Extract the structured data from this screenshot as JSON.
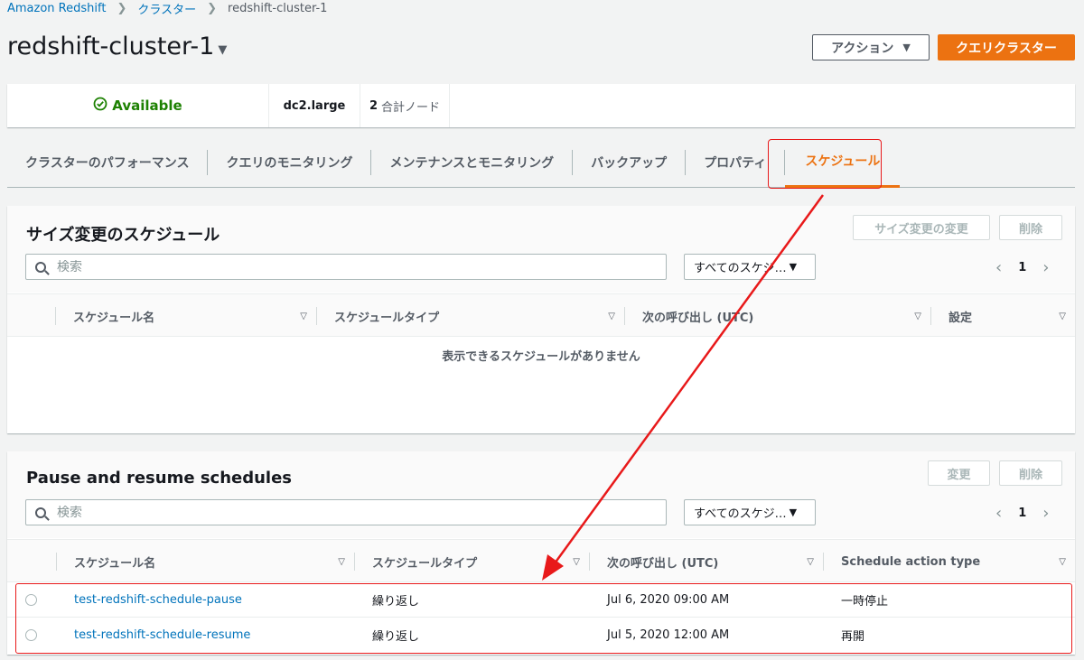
{
  "breadcrumb": {
    "items": [
      "Amazon Redshift",
      "クラスター"
    ],
    "current": "redshift-cluster-1"
  },
  "header": {
    "title": "redshift-cluster-1",
    "actions_label": "アクション",
    "query_label": "クエリクラスター"
  },
  "status": {
    "state": "Available",
    "node_type": "dc2.large",
    "node_count": "2",
    "node_label": "合計ノード"
  },
  "tabs": [
    {
      "label": "クラスターのパフォーマンス"
    },
    {
      "label": "クエリのモニタリング"
    },
    {
      "label": "メンテナンスとモニタリング"
    },
    {
      "label": "バックアップ"
    },
    {
      "label": "プロパティ"
    },
    {
      "label": "スケジュール",
      "active": true
    }
  ],
  "resize_panel": {
    "title": "サイズ変更のスケジュール",
    "modify_label": "サイズ変更の変更",
    "delete_label": "削除",
    "search_placeholder": "検索",
    "filter_value": "すべてのスケジ…",
    "page": "1",
    "columns": [
      "スケジュール名",
      "スケジュールタイプ",
      "次の呼び出し (UTC)",
      "設定"
    ],
    "empty_message": "表示できるスケジュールがありません"
  },
  "pause_panel": {
    "title": "Pause and resume schedules",
    "modify_label": "変更",
    "delete_label": "削除",
    "search_placeholder": "検索",
    "filter_value": "すべてのスケジ…",
    "page": "1",
    "columns": [
      "スケジュール名",
      "スケジュールタイプ",
      "次の呼び出し (UTC)",
      "Schedule action type"
    ],
    "rows": [
      {
        "name": "test-redshift-schedule-pause",
        "type": "繰り返し",
        "next": "Jul 6, 2020 09:00 AM",
        "action": "一時停止"
      },
      {
        "name": "test-redshift-schedule-resume",
        "type": "繰り返し",
        "next": "Jul 5, 2020 12:00 AM",
        "action": "再開"
      }
    ]
  },
  "colors": {
    "accent": "#ec7211",
    "link": "#0073bb",
    "success": "#1d8102",
    "annotation": "#e8191a"
  }
}
